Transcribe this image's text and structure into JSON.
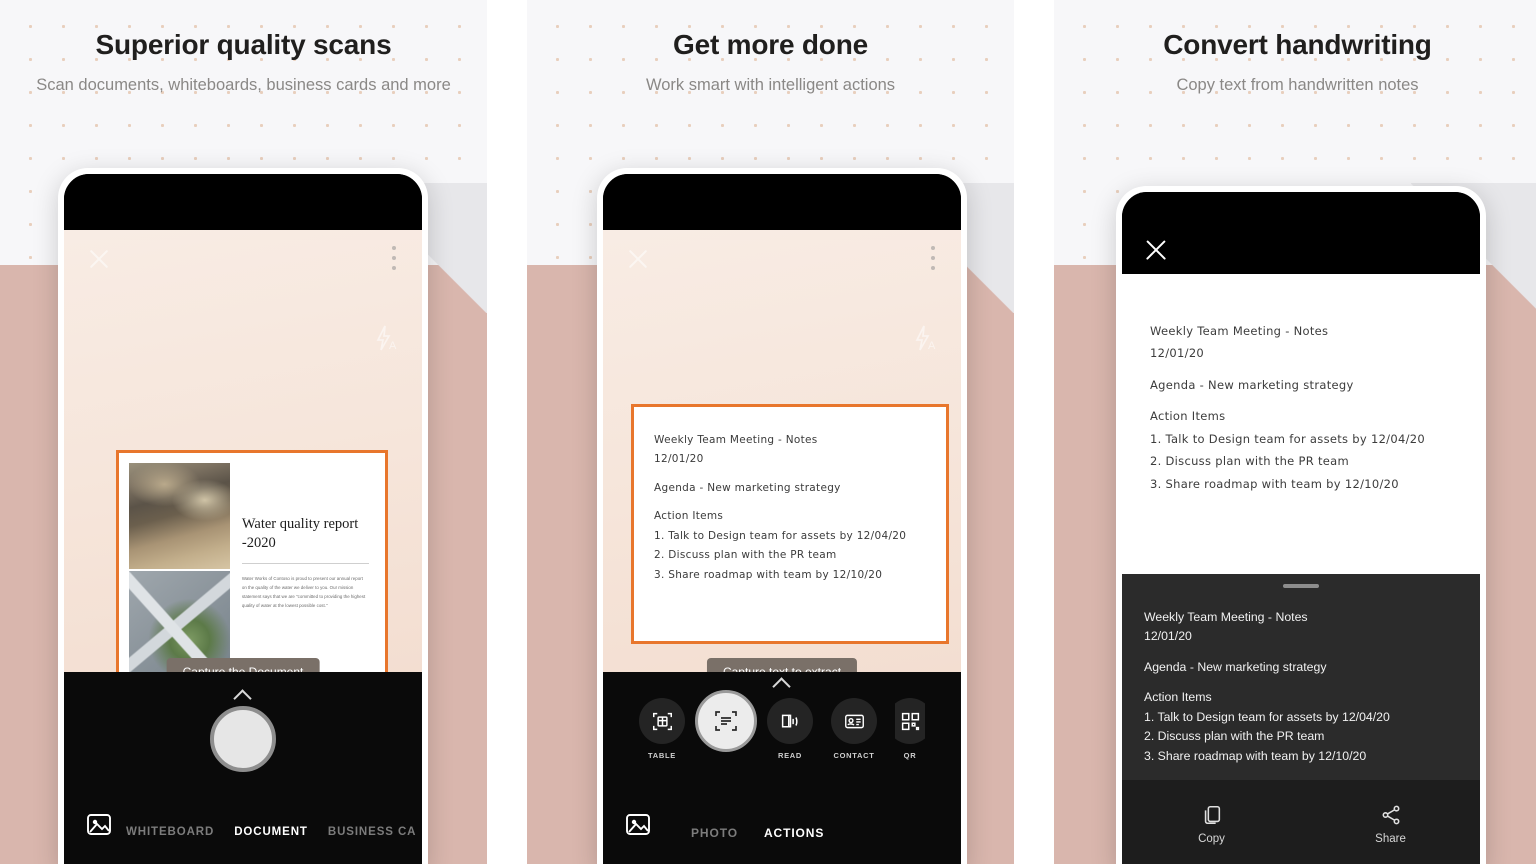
{
  "panels": [
    {
      "heading": "Superior quality scans",
      "subheading": "Scan documents, whiteboards, business cards and more",
      "capture_hint": "Capture the Document",
      "document": {
        "title": "Water quality report -2020",
        "body": "Water Works of Contoso is proud to present our annual report on the quality of the water we deliver to you. Our mission statement says that we are \"committed to providing the highest quality of water at the lowest possible cost.\"",
        "images": [
          "riverbank-photo",
          "highway-interchange-photo",
          "dam-spillway-photo"
        ]
      },
      "camera_modes": [
        "WHITEBOARD",
        "DOCUMENT",
        "BUSINESS CA"
      ],
      "active_mode": "DOCUMENT",
      "icons": {
        "close": "close-icon",
        "overflow": "more-options-icon",
        "flash": "flash-auto-icon",
        "gallery": "gallery-icon",
        "shutter": "shutter-button",
        "chevron": "chevron-up-icon"
      }
    },
    {
      "heading": "Get more done",
      "subheading": "Work smart with intelligent actions",
      "capture_hint": "Capture text to extract",
      "note": {
        "line1": "Weekly Team Meeting - Notes",
        "line2": "12/01/20",
        "line3": "Agenda - New marketing strategy",
        "line4": "Action Items",
        "line5": "1. Talk to Design team for assets by 12/04/20",
        "line6": "2. Discuss plan with the PR team",
        "line7": "3. Share roadmap with team by 12/10/20"
      },
      "actions": [
        {
          "label": "TABLE",
          "icon": "table-scan-icon"
        },
        {
          "label": "",
          "icon": "text-scan-icon"
        },
        {
          "label": "READ",
          "icon": "read-aloud-icon"
        },
        {
          "label": "CONTACT",
          "icon": "contact-card-icon"
        },
        {
          "label": "QR",
          "icon": "qr-code-icon"
        }
      ],
      "camera_modes": [
        "PHOTO",
        "ACTIONS"
      ],
      "active_mode": "ACTIONS"
    },
    {
      "heading": "Convert handwriting",
      "subheading": "Copy text from handwritten notes",
      "note": {
        "line1": "Weekly Team Meeting - Notes",
        "line2": "12/01/20",
        "line3": "Agenda - New marketing strategy",
        "line4": "Action Items",
        "line5": "1. Talk to Design team for assets by 12/04/20",
        "line6": "2. Discuss plan with the PR team",
        "line7": "3. Share roadmap with team by 12/10/20"
      },
      "extracted": {
        "line1": "Weekly Team Meeting - Notes",
        "line2": "12/01/20",
        "line3": "Agenda - New marketing strategy",
        "line4": "Action Items",
        "line5": "1. Talk to Design team for assets by 12/04/20",
        "line6": "2. Discuss plan with the PR team",
        "line7": "3. Share roadmap with team by 12/10/20"
      },
      "result_actions": [
        {
          "label": "Copy",
          "icon": "copy-icon"
        },
        {
          "label": "Share",
          "icon": "share-icon"
        }
      ]
    }
  ],
  "colors": {
    "accent_orange": "#e8762c",
    "pink_band": "#d9b6ad",
    "panel_bg": "#f7f7f9",
    "dot": "#e8cfbd",
    "heading": "#201f1e",
    "subheading": "#8a8886"
  }
}
